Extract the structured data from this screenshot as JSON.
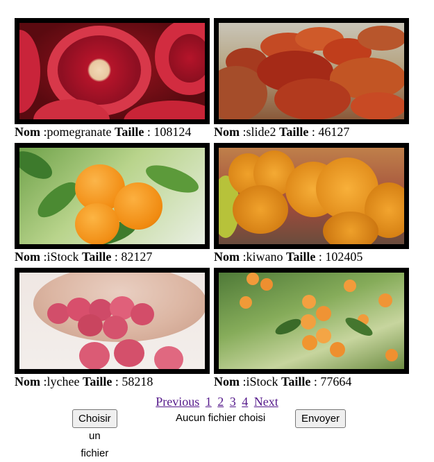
{
  "labels": {
    "nom": "Nom",
    "taille": "Taille"
  },
  "images": [
    {
      "name": "pomegranate",
      "size": "108124",
      "photo": "pomegranate-photo"
    },
    {
      "name": "slide2",
      "size": "46127",
      "photo": "jujube-photo"
    },
    {
      "name": "iStock",
      "size": "82127",
      "photo": "orange-tree-photo"
    },
    {
      "name": "kiwano",
      "size": "102405",
      "photo": "kiwano-photo"
    },
    {
      "name": "lychee",
      "size": "58218",
      "photo": "lychee-photo"
    },
    {
      "name": "iStock",
      "size": "77664",
      "photo": "apricot-tree-photo"
    }
  ],
  "pagination": {
    "previous": "Previous",
    "pages": [
      "1",
      "2",
      "3",
      "4"
    ],
    "next": "Next"
  },
  "upload": {
    "choose_label": "Choisir un fichier",
    "no_file_label": "Aucun fichier choisi",
    "submit_label": "Envoyer"
  },
  "colors": {
    "link": "#551a8b",
    "frame": "#000000",
    "button_bg": "#efefef"
  }
}
